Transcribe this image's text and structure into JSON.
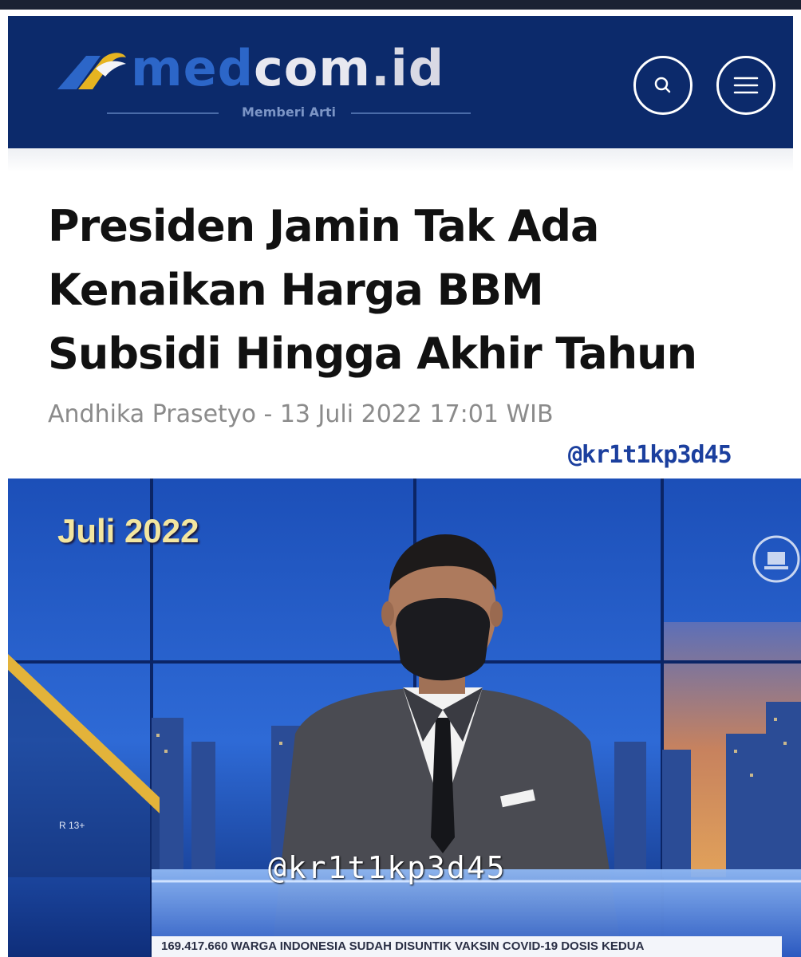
{
  "header": {
    "logo": {
      "part1": "med",
      "part2": "com",
      "part3": ".id",
      "tagline": "Memberi Arti"
    },
    "search_icon": "search-icon",
    "menu_icon": "hamburger-menu-icon",
    "brand_color": "#0c2a6b"
  },
  "article": {
    "headline_lines": [
      "Presiden Jamin Tak Ada",
      "Kenaikan Harga BBM",
      "Subsidi Hingga Akhir Tahun"
    ],
    "byline": "Andhika Prasetyo - 13 Juli 2022 17:01 WIB",
    "watermark": "@kr1t1kp3d45"
  },
  "video": {
    "date_overlay": "Juli 2022",
    "rating": "R 13+",
    "watermark": "@kr1t1kp3d45",
    "ticker": "169.417.660 WARGA INDONESIA SUDAH DISUNTIK VAKSIN COVID-19 DOSIS KEDUA"
  }
}
